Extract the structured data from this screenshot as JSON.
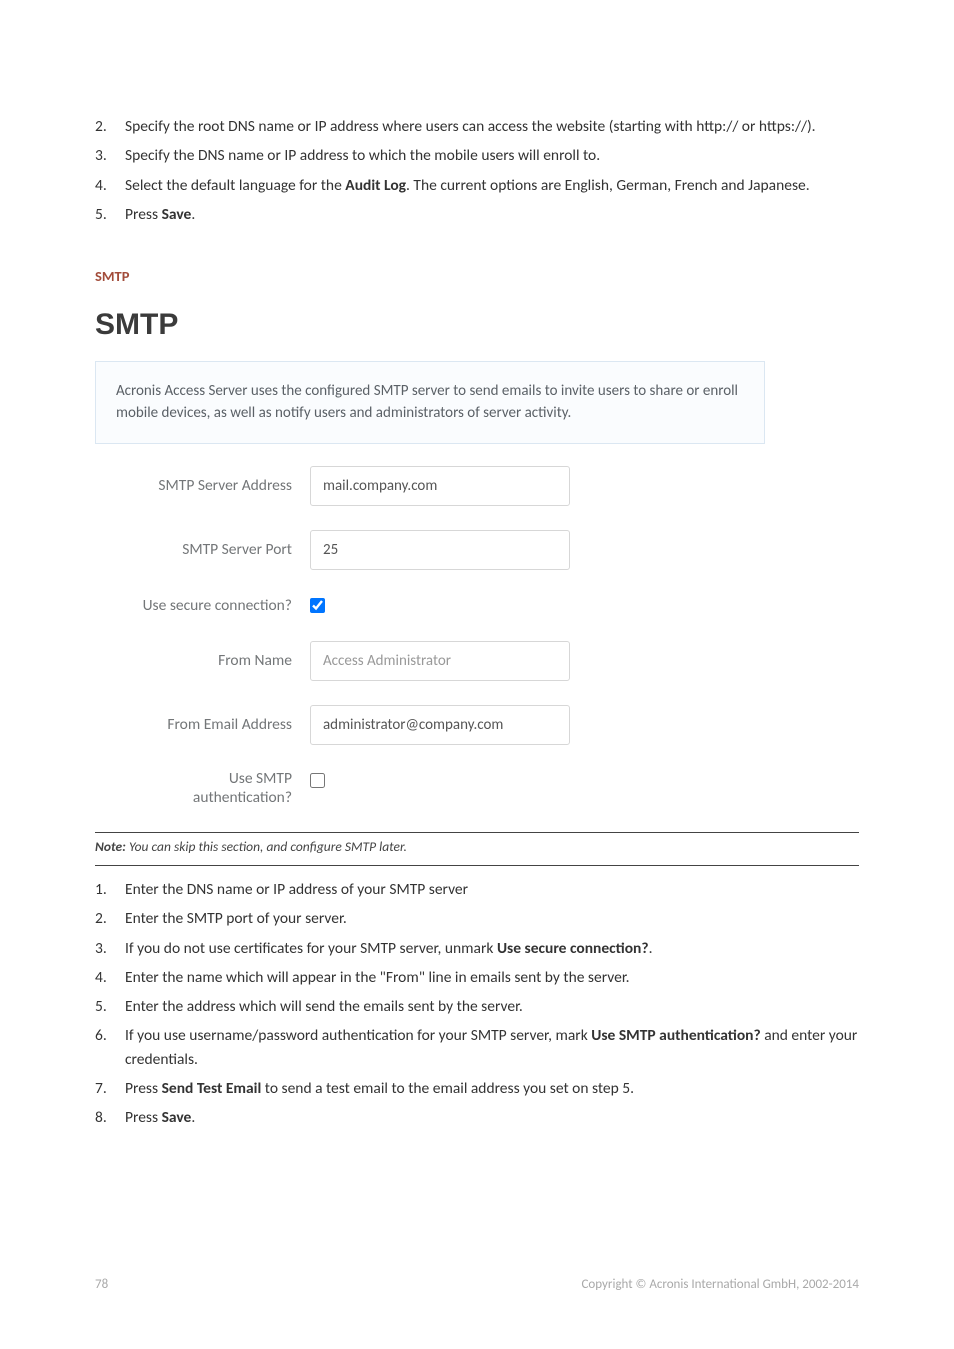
{
  "top_list": [
    {
      "num": "2",
      "text_before": "Specify the root DNS name or IP address where users can access the website (starting with http:// or https://).",
      "bold": "",
      "text_after": ""
    },
    {
      "num": "3",
      "text_before": "Specify the DNS name or IP address to which the mobile users will enroll to.",
      "bold": "",
      "text_after": ""
    },
    {
      "num": "4",
      "text_before": "Select the default language for the ",
      "bold": "Audit Log",
      "text_after": ". The current options are English, German, French and Japanese."
    },
    {
      "num": "5",
      "text_before": "Press ",
      "bold": "Save",
      "text_after": "."
    }
  ],
  "subhead": "SMTP",
  "smtp_heading": "SMTP",
  "info_text": "Acronis Access Server uses the configured SMTP server to send emails to invite users to share or enroll mobile devices, as well as notify users and administrators of server activity.",
  "form": {
    "server_address": {
      "label": "SMTP Server Address",
      "value": "mail.company.com"
    },
    "server_port": {
      "label": "SMTP Server Port",
      "value": "25"
    },
    "secure": {
      "label": "Use secure connection?",
      "checked": true
    },
    "from_name": {
      "label": "From Name",
      "placeholder": "Access Administrator",
      "value": ""
    },
    "from_email": {
      "label": "From Email Address",
      "value": "administrator@company.com"
    },
    "auth": {
      "label_line1": "Use SMTP",
      "label_line2": "authentication?",
      "checked": false
    }
  },
  "note_prefix": "Note:",
  "note_text": " You can skip this section, and configure SMTP later.",
  "bottom_list": [
    {
      "num": "1",
      "text_before": "Enter the DNS name or IP address of your SMTP server",
      "bold": "",
      "text_after": ""
    },
    {
      "num": "2",
      "text_before": "Enter the SMTP port of your server.",
      "bold": "",
      "text_after": ""
    },
    {
      "num": "3",
      "text_before": "If you do not use certificates for your SMTP server, unmark ",
      "bold": "Use secure connection?",
      "text_after": "."
    },
    {
      "num": "4",
      "text_before": "Enter the name which will appear in the \"From\" line in emails sent by the server.",
      "bold": "",
      "text_after": ""
    },
    {
      "num": "5",
      "text_before": "Enter the address which will send the emails sent by the server.",
      "bold": "",
      "text_after": ""
    },
    {
      "num": "6",
      "text_before": "If you use username/password authentication for your SMTP server, mark ",
      "bold": "Use SMTP authentication?",
      "text_after": " and enter your credentials."
    },
    {
      "num": "7",
      "text_before": "Press ",
      "bold": "Send Test Email",
      "text_after": " to send a test email to the email address you set on step 5."
    },
    {
      "num": "8",
      "text_before": "Press ",
      "bold": "Save",
      "text_after": "."
    }
  ],
  "footer": {
    "page": "78",
    "copyright": "Copyright © Acronis International GmbH, 2002-2014"
  }
}
